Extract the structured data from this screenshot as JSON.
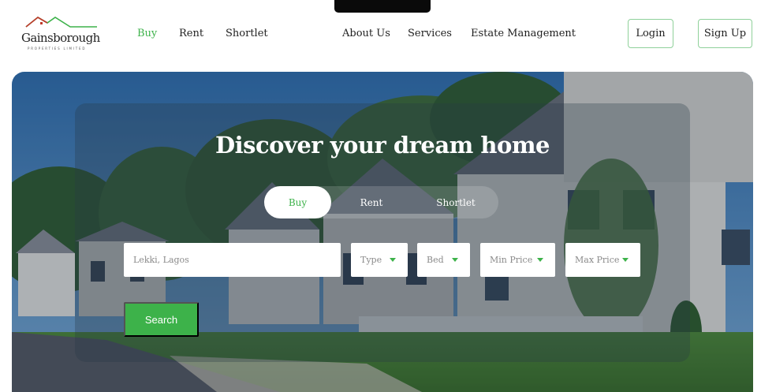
{
  "brand": {
    "name": "Gainsborough",
    "tagline": "PROPERTIES LIMITED",
    "roof_color": "#c0392b",
    "accent_color": "#3db24a"
  },
  "nav": {
    "left": [
      {
        "label": "Buy",
        "active": true
      },
      {
        "label": "Rent",
        "active": false
      },
      {
        "label": "Shortlet",
        "active": false
      }
    ],
    "right": [
      {
        "label": "About Us"
      },
      {
        "label": "Services"
      },
      {
        "label": "Estate Management"
      }
    ]
  },
  "auth": {
    "login_label": "Login",
    "signup_label": "Sign Up"
  },
  "hero": {
    "title": "Discover your dream home",
    "tabs": [
      {
        "label": "Buy",
        "active": true
      },
      {
        "label": "Rent",
        "active": false
      },
      {
        "label": "Shortlet",
        "active": false
      }
    ]
  },
  "search": {
    "location_placeholder": "Lekki, Lagos",
    "filters": [
      {
        "label": "Type",
        "icon": "caret-down-icon"
      },
      {
        "label": "Bed",
        "icon": "caret-down-icon"
      },
      {
        "label": "Min Price",
        "icon": "caret-down-icon"
      },
      {
        "label": "Max Price",
        "icon": "caret-down-icon"
      }
    ],
    "button_label": "Search"
  }
}
